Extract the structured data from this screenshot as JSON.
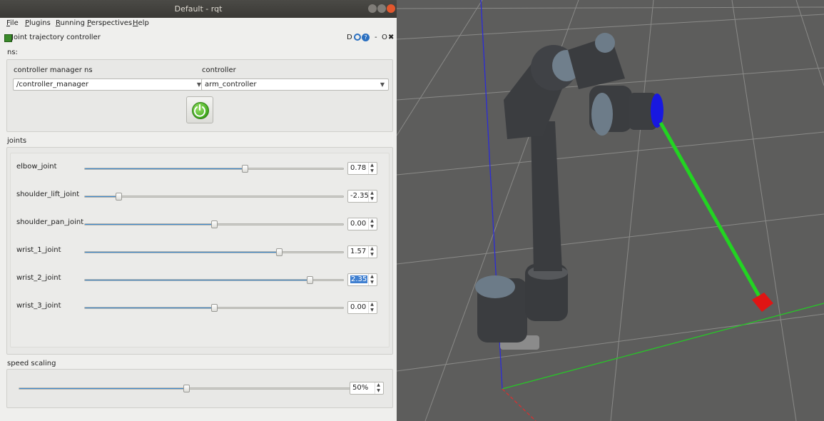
{
  "window": {
    "title": "Default - rqt"
  },
  "menubar": {
    "items": [
      {
        "label": "File",
        "u": "F",
        "rest": "ile"
      },
      {
        "label": "Plugins",
        "u": "P",
        "rest": "lugins"
      },
      {
        "label": "Running",
        "u": "R",
        "rest": "unning"
      },
      {
        "label": "Perspectives",
        "u": "P",
        "rest": "erspectives"
      },
      {
        "label": "Help",
        "u": "H",
        "rest": "elp"
      }
    ]
  },
  "plugin": {
    "title": "Joint trajectory controller",
    "controls": "D",
    "minus": "-",
    "o": "O",
    "close": "✖"
  },
  "ns": {
    "label": "ns:"
  },
  "controller_manager": {
    "label": "controller manager ns",
    "value": "/controller_manager"
  },
  "controller": {
    "label": "controller",
    "value": "arm_controller"
  },
  "joints": {
    "label": "joints",
    "items": [
      {
        "name": "elbow_joint",
        "value": "0.78",
        "fraction": 0.62
      },
      {
        "name": "shoulder_lift_joint",
        "value": "-2.35",
        "fraction": 0.13
      },
      {
        "name": "shoulder_pan_joint",
        "value": "0.00",
        "fraction": 0.5
      },
      {
        "name": "wrist_1_joint",
        "value": "1.57",
        "fraction": 0.75
      },
      {
        "name": "wrist_2_joint",
        "value": "2.35",
        "fraction": 0.87,
        "selected": true
      },
      {
        "name": "wrist_3_joint",
        "value": "0.00",
        "fraction": 0.5
      }
    ]
  },
  "speed_scaling": {
    "label": "speed scaling",
    "value": "50%",
    "fraction": 0.5
  },
  "colors": {
    "slider": "#3d8ad0",
    "power": "#4cb520",
    "viewport": "#5d5d5c"
  },
  "icons": {
    "power": "power-icon",
    "help": "help-icon",
    "refresh": "refresh-icon"
  }
}
